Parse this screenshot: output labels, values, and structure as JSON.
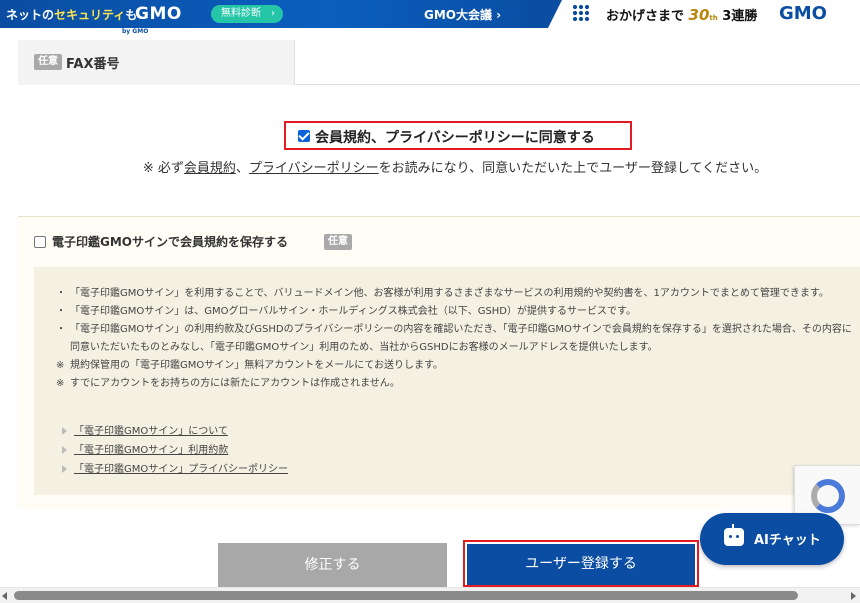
{
  "banner": {
    "security_prefix": "ネットの",
    "security_highlight": "セキュリティ",
    "security_suffix": "も",
    "gmo_logo": "GMO",
    "diagnosis_button": "無料診断",
    "diagnosis_arrow": "›",
    "conference": "GMO大会議 ›",
    "thanks_text": "おかげさまで",
    "thirty": "30",
    "thirty_suffix": "th",
    "consecutive": "3連勝",
    "gmo_logo_right": "GMO"
  },
  "site_header": {
    "by_gmo": "by GMO"
  },
  "fax_row": {
    "badge": "任意",
    "label": "FAX番号"
  },
  "agreement": {
    "checked": true,
    "label": "会員規約、プライバシーポリシーに同意する"
  },
  "notice": {
    "prefix": "※ 必ず",
    "terms_link": "会員規約",
    "separator": "、",
    "privacy_link": "プライバシーポリシー",
    "suffix": "をお読みになり、同意いただいた上でユーザー登録してください。"
  },
  "gmo_sign": {
    "checked": false,
    "label": "電子印鑑GMOサインで会員規約を保存する",
    "badge": "任意",
    "items": [
      {
        "mark": "・",
        "text": "「電子印鑑GMOサイン」を利用することで、バリュードメイン他、お客様が利用するさまざまなサービスの利用規約や契約書を、1アカウントでまとめて管理できます。"
      },
      {
        "mark": "・",
        "text": "「電子印鑑GMOサイン」は、GMOグローバルサイン・ホールディングス株式会社（以下、GSHD）が提供するサービスです。"
      },
      {
        "mark": "・",
        "text": "「電子印鑑GMOサイン」の利用約款及びGSHDのプライバシーポリシーの内容を確認いただき、「電子印鑑GMOサインで会員規約を保存する」を選択された場合、その内容に同意いただいたものとみなし、「電子印鑑GMOサイン」利用のため、当社からGSHDにお客様のメールアドレスを提供いたします。"
      },
      {
        "mark": "※",
        "text": "規約保管用の「電子印鑑GMOサイン」無料アカウントをメールにてお送りします。"
      },
      {
        "mark": "※",
        "text": "すでにアカウントをお持ちの方には新たにアカウントは作成されません。"
      }
    ],
    "links": [
      "「電子印鑑GMOサイン」について",
      "「電子印鑑GMOサイン」利用約款",
      "「電子印鑑GMOサイン」プライバシーポリシー"
    ]
  },
  "buttons": {
    "fix": "修正する",
    "register": "ユーザー登録する"
  },
  "ai_chat": {
    "label": "AIチャット"
  },
  "colors": {
    "brand_blue": "#0a4da2",
    "highlight_red": "#e31b23",
    "disabled_gray": "#a8a8a8",
    "panel_beige": "#f4f1e3"
  }
}
